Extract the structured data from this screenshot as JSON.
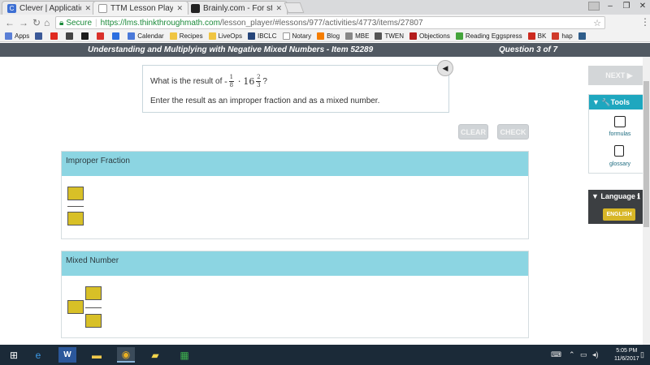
{
  "browser": {
    "tabs": [
      {
        "title": "Clever | Applications",
        "favicon": "C",
        "favicon_color": "#3d6fd3",
        "active": false
      },
      {
        "title": "TTM Lesson Player",
        "favicon": "",
        "favicon_color": "#ffffff",
        "active": true
      },
      {
        "title": "Brainly.com - For studen",
        "favicon": "",
        "favicon_color": "#222222",
        "active": false
      }
    ],
    "secure_label": "Secure",
    "url_host": "https://lms.thinkthroughmath.com",
    "url_path": "/lesson_player/#lessons/977/activities/4773/items/27807",
    "bookmarks": [
      {
        "label": "Apps",
        "color": "#5a7fd6"
      },
      {
        "label": "",
        "color": "#3b5998"
      },
      {
        "label": "",
        "color": "#e02a20"
      },
      {
        "label": "",
        "color": "#444444"
      },
      {
        "label": "",
        "color": "#1c1c1c"
      },
      {
        "label": "",
        "color": "#d9302a"
      },
      {
        "label": "",
        "color": "#2b6ee0"
      },
      {
        "label": "Calendar",
        "color": "#4a79d9"
      },
      {
        "label": "Recipes",
        "color": "#f0c542"
      },
      {
        "label": "LiveOps",
        "color": "#f0c542"
      },
      {
        "label": "IBCLC",
        "color": "#26457a"
      },
      {
        "label": "Notary",
        "color": "#ffffff"
      },
      {
        "label": "Blog",
        "color": "#f57d00"
      },
      {
        "label": "MBE",
        "color": "#888888"
      },
      {
        "label": "TWEN",
        "color": "#555555"
      },
      {
        "label": "Objections",
        "color": "#b31c1c"
      },
      {
        "label": "Reading Eggspress",
        "color": "#44a43b"
      },
      {
        "label": "BK",
        "color": "#cc2a1f"
      },
      {
        "label": "hap",
        "color": "#d03a2a"
      },
      {
        "label": "",
        "color": "#2f5d8a"
      }
    ]
  },
  "lesson": {
    "title": "Understanding and Multiplying with Negative Mixed Numbers - Item 52289",
    "question_counter": "Question 3 of 7"
  },
  "question": {
    "prompt_prefix": "What is the result of",
    "neg_sign": "-",
    "frac1_num": "1",
    "frac1_den": "8",
    "operator": "·",
    "mixed_whole": "16",
    "frac2_num": "2",
    "frac2_den": "3",
    "qmark": "?",
    "instruction": "Enter the result as an improper fraction and as a mixed number."
  },
  "buttons": {
    "clear": "CLEAR",
    "check": "CHECK",
    "next": "NEXT ▶"
  },
  "panels": {
    "improper_title": "Improper Fraction",
    "mixed_title": "Mixed Number"
  },
  "sidebar": {
    "tools_header": "▼ 🔧Tools",
    "formulas_label": "formulas",
    "glossary_label": "glossary",
    "language_header": "▼ Language ℹ",
    "language_button": "ENGLISH"
  },
  "taskbar": {
    "time": "5:05 PM",
    "date": "11/6/2017"
  },
  "colors": {
    "accent_teal": "#1ea7bf",
    "panel_header": "#8cd5e2",
    "answer_box": "#d8c027",
    "header_bar": "#515962"
  }
}
